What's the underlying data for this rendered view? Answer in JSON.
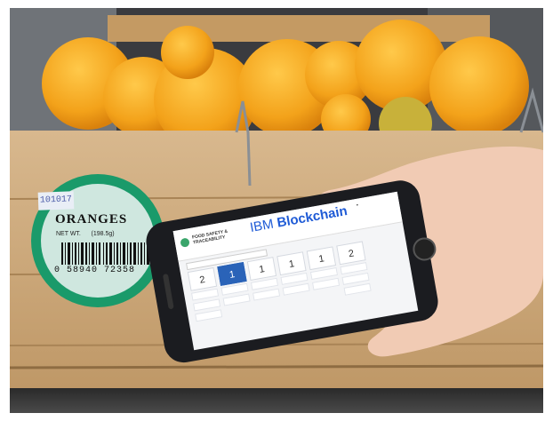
{
  "label": {
    "code": "101017",
    "title": "ORANGES",
    "net_wt_label": "NET WT.",
    "net_wt_value": "(198.5g)",
    "barcode_number": "0 58940 72358"
  },
  "phone_app": {
    "brand": "FOOD SAFETY & TRACEABILITY",
    "title_prefix": "IBM",
    "title_main": "Blockchain",
    "stage_counts": [
      "2",
      "1",
      "1",
      "1",
      "1",
      "2"
    ],
    "active_stage_index": 1
  },
  "colors": {
    "label_ring": "#1a9a6a",
    "label_fill": "#cfe7df",
    "ibm_blue": "#1f5bd6",
    "active_stage": "#2a63b8",
    "orange": "#f3a21a",
    "crate_wood": "#c9a57a"
  }
}
